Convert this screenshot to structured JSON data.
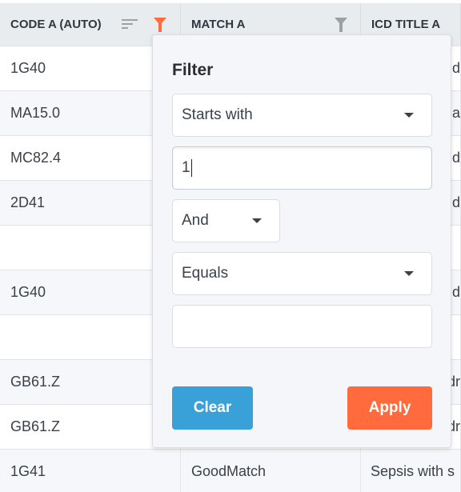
{
  "columns": [
    {
      "label": "CODE A (AUTO)",
      "filter_active": true
    },
    {
      "label": "MATCH A",
      "filter_active": false
    },
    {
      "label": "ICD TITLE A"
    }
  ],
  "rows": [
    {
      "code": "1G40",
      "match": "",
      "title": "nd"
    },
    {
      "code": "MA15.0",
      "match": "",
      "title": "ia"
    },
    {
      "code": "MC82.4",
      "match": "",
      "title": "nd"
    },
    {
      "code": "2D41",
      "match": "",
      "title": "d"
    },
    {
      "code": "",
      "match": "",
      "title": ""
    },
    {
      "code": "1G40",
      "match": "",
      "title": "nd"
    },
    {
      "code": "",
      "match": "",
      "title": ""
    },
    {
      "code": "GB61.Z",
      "match": "",
      "title": "dr"
    },
    {
      "code": "GB61.Z",
      "match": "",
      "title": "dr"
    },
    {
      "code": "1G41",
      "match": "GoodMatch",
      "title": "Sepsis with s"
    }
  ],
  "filter": {
    "title": "Filter",
    "condition1": "Starts with",
    "value1": "1",
    "operator": "And",
    "condition2": "Equals",
    "value2": "",
    "clear_label": "Clear",
    "apply_label": "Apply"
  },
  "colors": {
    "active_filter": "#ff6b3d",
    "inactive_filter": "#9aa2a6",
    "clear": "#3aa0d8",
    "apply": "#ff6b3d"
  }
}
